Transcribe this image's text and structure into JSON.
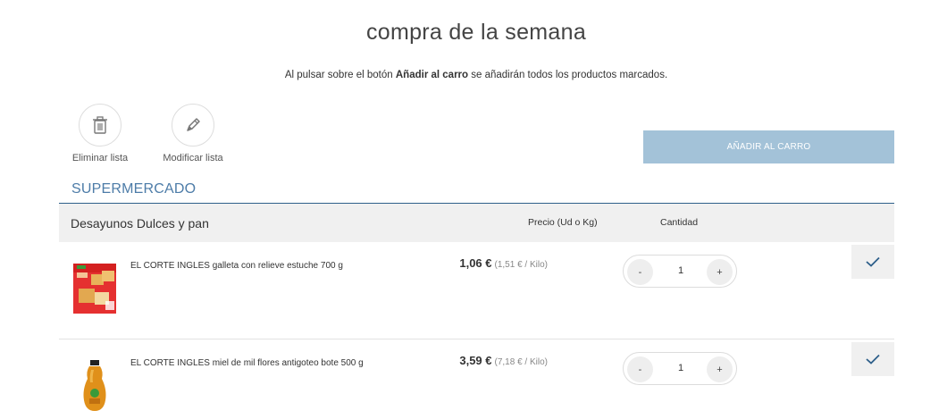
{
  "page": {
    "title": "compra de la semana",
    "subtitle_prefix": "Al pulsar sobre el botón ",
    "subtitle_bold": "Añadir al carro",
    "subtitle_suffix": " se añadirán todos los productos marcados."
  },
  "actions": {
    "delete_label": "Eliminar lista",
    "delete_icon": "trash-icon",
    "edit_label": "Modificar lista",
    "edit_icon": "pencil-icon",
    "add_to_cart_label": "AÑADIR AL CARRO"
  },
  "section": {
    "title": "SUPERMERCADO",
    "category": {
      "title": "Desayunos Dulces y pan",
      "price_header": "Precio (Ud o Kg)",
      "quantity_header": "Cantidad"
    }
  },
  "products": [
    {
      "name": "EL CORTE INGLES galleta con relieve estuche 700 g",
      "price": "1,06 €",
      "unit_price": "(1,51 € / Kilo)",
      "quantity": "1",
      "minus": "-",
      "plus": "+",
      "checked": true
    },
    {
      "name": "EL CORTE INGLES miel de mil flores antigoteo bote 500 g",
      "price": "3,59 €",
      "unit_price": "(7,18 € / Kilo)",
      "quantity": "1",
      "minus": "-",
      "plus": "+",
      "checked": true
    }
  ],
  "colors": {
    "accent": "#4d7ca8",
    "button_disabled": "#a3c2d8",
    "check": "#2e5f8a"
  }
}
